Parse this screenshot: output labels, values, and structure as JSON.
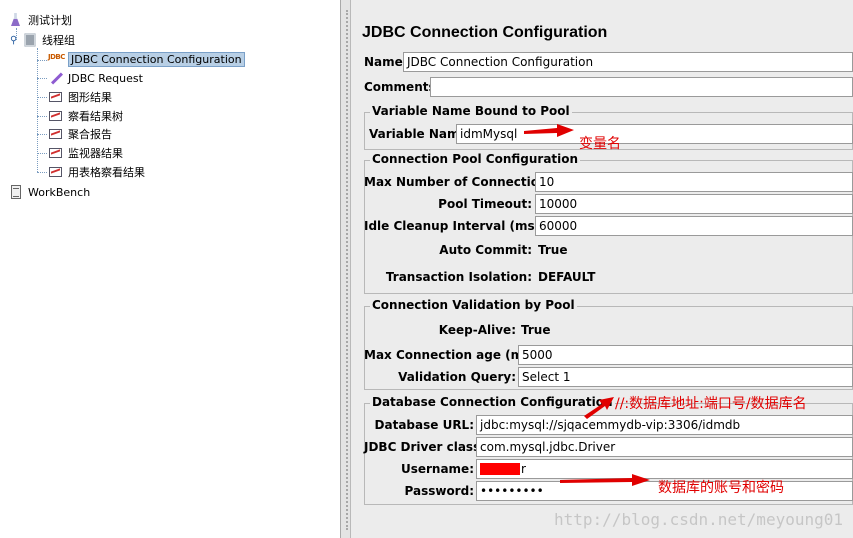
{
  "tree": {
    "test_plan": "测试计划",
    "thread_group": "线程组",
    "children": [
      {
        "label": "JDBC Connection Configuration",
        "icon": "jdbc-config-icon"
      },
      {
        "label": "JDBC Request",
        "icon": "pen-icon"
      },
      {
        "label": "图形结果",
        "icon": "graph-results-icon"
      },
      {
        "label": "察看结果树",
        "icon": "results-tree-icon"
      },
      {
        "label": "聚合报告",
        "icon": "aggregate-report-icon"
      },
      {
        "label": "监视器结果",
        "icon": "monitor-results-icon"
      },
      {
        "label": "用表格察看结果",
        "icon": "table-results-icon"
      }
    ],
    "workbench": "WorkBench"
  },
  "panel": {
    "title": "JDBC Connection Configuration",
    "name_label": "Name:",
    "name_value": "JDBC Connection Configuration",
    "comments_label": "Comments:",
    "comments_value": "",
    "var_group": {
      "legend": "Variable Name Bound to Pool",
      "label": "Variable Name:",
      "value": "idmMysql"
    },
    "pool_group": {
      "legend": "Connection Pool Configuration",
      "max_conn_label": "Max Number of Connections:",
      "max_conn_value": "10",
      "timeout_label": "Pool Timeout:",
      "timeout_value": "10000",
      "idle_label": "Idle Cleanup Interval (ms):",
      "idle_value": "60000",
      "autocommit_label": "Auto Commit:",
      "autocommit_value": "True",
      "isolation_label": "Transaction Isolation:",
      "isolation_value": "DEFAULT"
    },
    "validation_group": {
      "legend": "Connection Validation by Pool",
      "keepalive_label": "Keep-Alive:",
      "keepalive_value": "True",
      "maxage_label": "Max Connection age (ms):",
      "maxage_value": "5000",
      "query_label": "Validation Query:",
      "query_value": "Select 1"
    },
    "db_group": {
      "legend": "Database Connection Configuration",
      "url_label": "Database URL:",
      "url_value": "jdbc:mysql://sjqacemmydb-vip:3306/idmdb",
      "driver_label": "JDBC Driver class:",
      "driver_value": "com.mysql.jdbc.Driver",
      "user_label": "Username:",
      "user_value": "r",
      "pass_label": "Password:",
      "pass_value": "•••••••••"
    }
  },
  "annotations": {
    "varname": "变量名",
    "url": "//:数据库地址:端口号/数据库名",
    "account": "数据库的账号和密码"
  },
  "watermark": "http://blog.csdn.net/meyoung01",
  "colors": {
    "annotation": "#e00000",
    "selection": "#b8cfe5"
  }
}
